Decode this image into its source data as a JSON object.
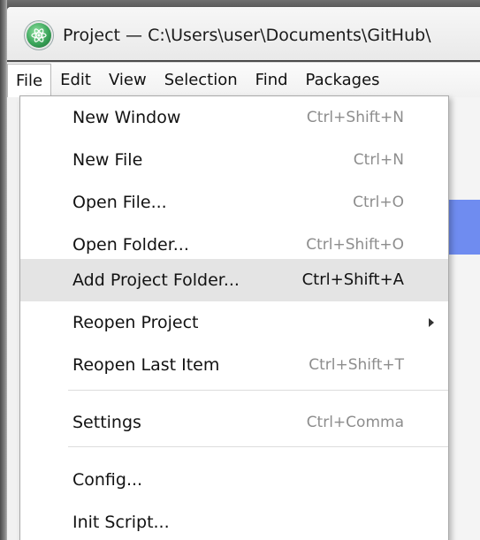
{
  "window": {
    "title": "Project — C:\\Users\\user\\Documents\\GitHub\\"
  },
  "menubar": {
    "items": [
      {
        "label": "File"
      },
      {
        "label": "Edit"
      },
      {
        "label": "View"
      },
      {
        "label": "Selection"
      },
      {
        "label": "Find"
      },
      {
        "label": "Packages"
      }
    ]
  },
  "file_menu": {
    "items": [
      {
        "label": "New Window",
        "shortcut": "Ctrl+Shift+N"
      },
      {
        "label": "New File",
        "shortcut": "Ctrl+N"
      },
      {
        "label": "Open File...",
        "shortcut": "Ctrl+O"
      },
      {
        "label": "Open Folder...",
        "shortcut": "Ctrl+Shift+O"
      },
      {
        "label": "Add Project Folder...",
        "shortcut": "Ctrl+Shift+A"
      },
      {
        "label": "Reopen Project",
        "shortcut": ""
      },
      {
        "label": "Reopen Last Item",
        "shortcut": "Ctrl+Shift+T"
      },
      {
        "label": "Settings",
        "shortcut": "Ctrl+Comma"
      },
      {
        "label": "Config...",
        "shortcut": ""
      },
      {
        "label": "Init Script...",
        "shortcut": ""
      }
    ]
  },
  "colors": {
    "highlight": "#e4e4e4",
    "selection_blue": "#6f8cf0",
    "app_icon": "#3aa55a"
  },
  "icons": {
    "app": "atom-icon",
    "submenu": "chevron-right-icon"
  }
}
